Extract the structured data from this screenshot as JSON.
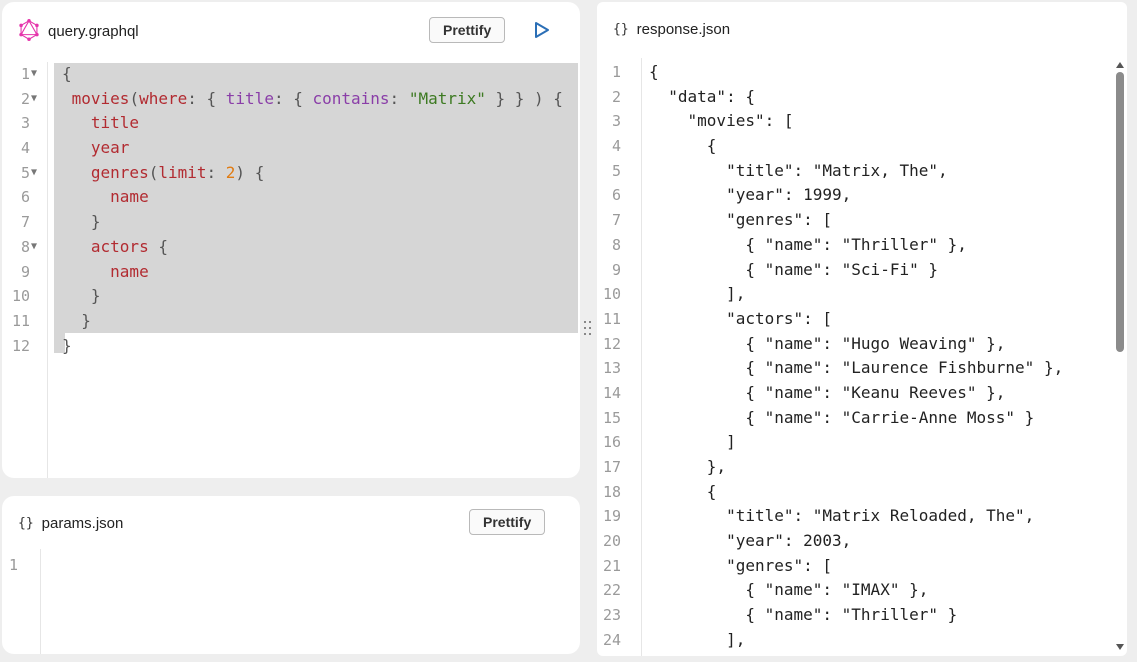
{
  "query_panel": {
    "title": "query.graphql",
    "prettify_label": "Prettify",
    "line_numbers": [
      "1",
      "2",
      "3",
      "4",
      "5",
      "6",
      "7",
      "8",
      "9",
      "10",
      "11",
      "12"
    ],
    "fold_markers": [
      "▼",
      "▼",
      "",
      "",
      "▼",
      "",
      "",
      "▼",
      "",
      "",
      "",
      ""
    ],
    "lines": [
      [
        {
          "t": "{",
          "c": "punc"
        }
      ],
      [
        {
          "t": " movies",
          "c": "field"
        },
        {
          "t": "(",
          "c": "punc"
        },
        {
          "t": "where",
          "c": "field"
        },
        {
          "t": ": { ",
          "c": "punc"
        },
        {
          "t": "title",
          "c": "arg"
        },
        {
          "t": ": { ",
          "c": "punc"
        },
        {
          "t": "contains",
          "c": "arg"
        },
        {
          "t": ": ",
          "c": "punc"
        },
        {
          "t": "\"Matrix\"",
          "c": "str"
        },
        {
          "t": " } } ) {",
          "c": "punc"
        }
      ],
      [
        {
          "t": "   title",
          "c": "field"
        }
      ],
      [
        {
          "t": "   year",
          "c": "field"
        }
      ],
      [
        {
          "t": "   genres",
          "c": "field"
        },
        {
          "t": "(",
          "c": "punc"
        },
        {
          "t": "limit",
          "c": "field"
        },
        {
          "t": ": ",
          "c": "punc"
        },
        {
          "t": "2",
          "c": "num"
        },
        {
          "t": ") {",
          "c": "punc"
        }
      ],
      [
        {
          "t": "     name",
          "c": "field"
        }
      ],
      [
        {
          "t": "   }",
          "c": "punc"
        }
      ],
      [
        {
          "t": "   actors",
          "c": "field"
        },
        {
          "t": " {",
          "c": "punc"
        }
      ],
      [
        {
          "t": "     name",
          "c": "field"
        }
      ],
      [
        {
          "t": "   }",
          "c": "punc"
        }
      ],
      [
        {
          "t": "  }",
          "c": "punc"
        }
      ],
      [
        {
          "t": "}",
          "c": "punc"
        }
      ]
    ]
  },
  "params_panel": {
    "title": "params.json",
    "prettify_label": "Prettify",
    "line_numbers": [
      "1"
    ]
  },
  "response_panel": {
    "title": "response.json",
    "line_numbers": [
      "1",
      "2",
      "3",
      "4",
      "5",
      "6",
      "7",
      "8",
      "9",
      "10",
      "11",
      "12",
      "13",
      "14",
      "15",
      "16",
      "17",
      "18",
      "19",
      "20",
      "21",
      "22",
      "23",
      "24"
    ],
    "lines": [
      "{",
      "  \"data\": {",
      "    \"movies\": [",
      "      {",
      "        \"title\": \"Matrix, The\",",
      "        \"year\": 1999,",
      "        \"genres\": [",
      "          { \"name\": \"Thriller\" },",
      "          { \"name\": \"Sci-Fi\" }",
      "        ],",
      "        \"actors\": [",
      "          { \"name\": \"Hugo Weaving\" },",
      "          { \"name\": \"Laurence Fishburne\" },",
      "          { \"name\": \"Keanu Reeves\" },",
      "          { \"name\": \"Carrie-Anne Moss\" }",
      "        ]",
      "      },",
      "      {",
      "        \"title\": \"Matrix Reloaded, The\",",
      "        \"year\": 2003,",
      "        \"genres\": [",
      "          { \"name\": \"IMAX\" },",
      "          { \"name\": \"Thriller\" }",
      "        ],"
    ]
  },
  "icons": {
    "logo": "graphql-logo-icon",
    "braces": "{}",
    "run": "play-icon"
  },
  "colors": {
    "graphql_pink": "#e535ab",
    "run_blue": "#2b6fb6",
    "field": "#b22b31",
    "arg": "#8a3ea8",
    "string": "#3d7a22",
    "number": "#e07b12",
    "selection": "#d6d6d6"
  }
}
